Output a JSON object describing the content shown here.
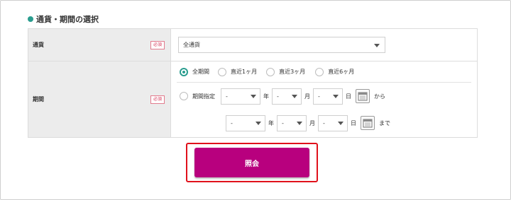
{
  "section": {
    "title": "通貨・期間の選択"
  },
  "currency_row": {
    "label": "通貨",
    "required": "必須",
    "select_value": "全通貨"
  },
  "period_row": {
    "label": "期間",
    "required": "必須",
    "options": [
      {
        "label": "全期間",
        "selected": true
      },
      {
        "label": "直近1ヶ月",
        "selected": false
      },
      {
        "label": "直近3ヶ月",
        "selected": false
      },
      {
        "label": "直近6ヶ月",
        "selected": false
      }
    ],
    "custom": {
      "label": "期間指定",
      "from": {
        "year": "-",
        "month": "-",
        "day": "-",
        "suffix": "から"
      },
      "to": {
        "year": "-",
        "month": "-",
        "day": "-",
        "suffix": "まで"
      },
      "year_unit": "年",
      "month_unit": "月",
      "day_unit": "日"
    }
  },
  "submit": {
    "label": "照会"
  },
  "colors": {
    "accent": "#2a9d8f",
    "button": "#b8007e",
    "highlight": "#e0111b"
  }
}
